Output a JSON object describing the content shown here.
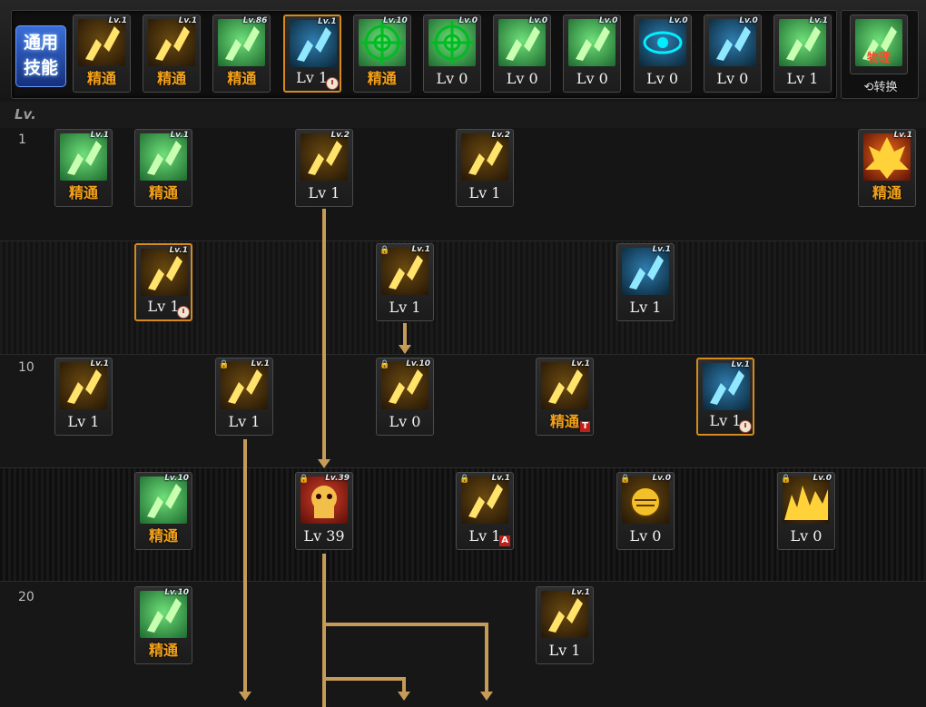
{
  "header": {
    "general_skills_label": "通用\n技能",
    "swap_label": "转换",
    "swap_icon": "refresh-icon",
    "lv_header": "Lv."
  },
  "top_skills": [
    {
      "icon": "crouch-figure",
      "tag": "Lv.1",
      "caption": "精通",
      "master": true,
      "color": "gold"
    },
    {
      "icon": "leg-sweep",
      "tag": "Lv.1",
      "caption": "精通",
      "master": true,
      "color": "gold"
    },
    {
      "icon": "slash-rune",
      "tag": "Lv.86",
      "caption": "精通",
      "master": true,
      "color": "green"
    },
    {
      "icon": "winged-spirit",
      "tag": "Lv.1",
      "caption": "Lv 1",
      "master": false,
      "color": "blue",
      "selected": true,
      "clock": true
    },
    {
      "icon": "crosshair",
      "tag": "Lv.10",
      "caption": "精通",
      "master": true,
      "color": "green"
    },
    {
      "icon": "crosshair",
      "tag": "Lv.0",
      "caption": "Lv 0",
      "master": false,
      "color": "green"
    },
    {
      "icon": "kneel-figure",
      "tag": "Lv.0",
      "caption": "Lv 0",
      "master": false,
      "color": "green"
    },
    {
      "icon": "kneel-figure",
      "tag": "Lv.0",
      "caption": "Lv 0",
      "master": false,
      "color": "green"
    },
    {
      "icon": "eye-ring",
      "tag": "Lv.0",
      "caption": "Lv 0",
      "master": false,
      "color": "blue"
    },
    {
      "icon": "standing-figure",
      "tag": "Lv.0",
      "caption": "Lv 0",
      "master": false,
      "color": "blue"
    },
    {
      "icon": "kick-figure",
      "tag": "Lv.1",
      "caption": "Lv 1",
      "master": false,
      "color": "green"
    }
  ],
  "swap_skill": {
    "icon": "physical-rune",
    "caption": "物理",
    "color": "green"
  },
  "row_numbers": {
    "r1": "1",
    "r3": "10",
    "r5": "20"
  },
  "tree_skills": [
    {
      "id": "r1c1",
      "icon": "scroll-punch",
      "tag": "Lv.1",
      "caption": "精通",
      "master": true,
      "color": "green",
      "row": 1,
      "col": 1
    },
    {
      "id": "r1c2",
      "icon": "stance-rune",
      "tag": "Lv.1",
      "caption": "精通",
      "master": true,
      "color": "green",
      "row": 1,
      "col": 2
    },
    {
      "id": "r1c4",
      "icon": "flying-kick",
      "tag": "Lv.2",
      "caption": "Lv 1",
      "master": false,
      "color": "gold",
      "row": 1,
      "col": 4
    },
    {
      "id": "r1c6",
      "icon": "uppercut",
      "tag": "Lv.2",
      "caption": "Lv 1",
      "master": false,
      "color": "gold",
      "row": 1,
      "col": 6
    },
    {
      "id": "r1c11",
      "icon": "flame-burst",
      "tag": "Lv.1",
      "caption": "精通",
      "master": true,
      "color": "fire",
      "row": 1,
      "col": 11
    },
    {
      "id": "r2c2",
      "icon": "shatter-burst",
      "tag": "Lv.1",
      "caption": "Lv 1",
      "master": false,
      "color": "gold",
      "row": 2,
      "col": 2,
      "selected": true,
      "clock": true
    },
    {
      "id": "r2c5",
      "icon": "speed-punch",
      "tag": "Lv.1",
      "caption": "Lv 1",
      "master": false,
      "color": "gold",
      "row": 2,
      "col": 5,
      "lock": true
    },
    {
      "id": "r2c8",
      "icon": "gauntlet",
      "tag": "Lv.1",
      "caption": "Lv 1",
      "master": false,
      "color": "blue",
      "row": 2,
      "col": 8
    },
    {
      "id": "r3c1",
      "icon": "lightning-strike",
      "tag": "Lv.1",
      "caption": "Lv 1",
      "master": false,
      "color": "gold",
      "row": 3,
      "col": 1
    },
    {
      "id": "r3c3",
      "icon": "crescent-slash",
      "tag": "Lv.1",
      "caption": "Lv 1",
      "master": false,
      "color": "gold",
      "row": 3,
      "col": 3,
      "lock": true
    },
    {
      "id": "r3c5",
      "icon": "grab-throw",
      "tag": "Lv.10",
      "caption": "Lv 0",
      "master": false,
      "color": "gold",
      "row": 3,
      "col": 5,
      "lock": true
    },
    {
      "id": "r3c7",
      "icon": "body-press",
      "tag": "Lv.1",
      "caption": "精通",
      "master": true,
      "color": "gold",
      "row": 3,
      "col": 7,
      "badge": "T"
    },
    {
      "id": "r3c9",
      "icon": "rising-flame",
      "tag": "Lv.1",
      "caption": "Lv 1",
      "master": false,
      "color": "blue",
      "row": 3,
      "col": 9,
      "selected": true,
      "clock": true
    },
    {
      "id": "r4c2",
      "icon": "strong-rune",
      "tag": "Lv.10",
      "caption": "精通",
      "master": true,
      "color": "green",
      "row": 4,
      "col": 2
    },
    {
      "id": "r4c4",
      "icon": "demon-mask",
      "tag": "Lv.39",
      "caption": "Lv 39",
      "master": false,
      "color": "red",
      "row": 4,
      "col": 4,
      "lock": true
    },
    {
      "id": "r4c6",
      "icon": "tornado-kick",
      "tag": "Lv.1",
      "caption": "Lv 1",
      "master": false,
      "color": "gold",
      "row": 4,
      "col": 6,
      "lock": true,
      "badge": "A"
    },
    {
      "id": "r4c8",
      "icon": "fist-orb",
      "tag": "Lv.0",
      "caption": "Lv 0",
      "master": false,
      "color": "gold",
      "row": 4,
      "col": 8,
      "lock": true
    },
    {
      "id": "r4c10",
      "icon": "firestorm",
      "tag": "Lv.0",
      "caption": "Lv 0",
      "master": false,
      "color": "gold",
      "row": 4,
      "col": 10,
      "lock": true
    },
    {
      "id": "r5c2",
      "icon": "rune-slash",
      "tag": "Lv.10",
      "caption": "精通",
      "master": true,
      "color": "green",
      "row": 5,
      "col": 2
    },
    {
      "id": "r5c7",
      "icon": "pistol-shield",
      "tag": "Lv.1",
      "caption": "Lv 1",
      "master": false,
      "color": "gold",
      "row": 5,
      "col": 7
    }
  ],
  "colors": {
    "gold": "#f0b21c",
    "green": "#38c05a",
    "blue": "#2a8fd0",
    "red": "#c8241c",
    "fire": "#e8521a",
    "connector": "#c59b58",
    "master": "#f5a21a",
    "selected_border": "#d68a1b"
  }
}
